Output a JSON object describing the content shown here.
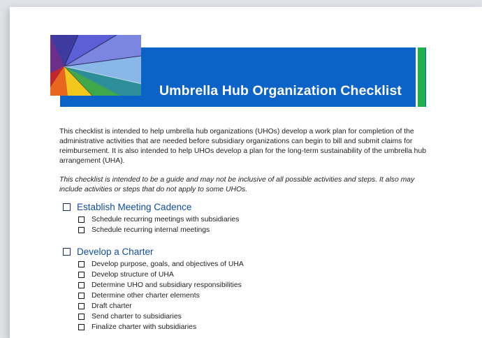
{
  "banner": {
    "title": "Umbrella Hub Organization Checklist",
    "color": "#0c63c7",
    "accent_color": "#1fb14a",
    "image": "umbrella-photo"
  },
  "intro": {
    "paragraph": "This checklist is intended to help umbrella hub organizations (UHOs) develop a work plan for completion of the administrative activities that are needed before subsidiary organizations can begin to bill and submit claims for reimbursement. It is also intended to help UHOs develop a plan for the long-term sustainability of the umbrella hub arrangement (UHA).",
    "note": "This checklist is intended to be a guide and may not be inclusive of all possible activities and steps. It also may include activities or steps that do not apply to some UHOs."
  },
  "sections": [
    {
      "title": "Establish Meeting Cadence",
      "items": [
        "Schedule recurring meetings with subsidiaries",
        "Schedule recurring internal meetings"
      ]
    },
    {
      "title": "Develop a Charter",
      "items": [
        "Develop purpose, goals, and objectives of UHA",
        "Develop structure of UHA",
        "Determine UHO and subsidiary responsibilities",
        "Determine other charter elements",
        "Draft charter",
        "Send charter to subsidiaries",
        "Finalize charter with subsidiaries"
      ]
    }
  ]
}
